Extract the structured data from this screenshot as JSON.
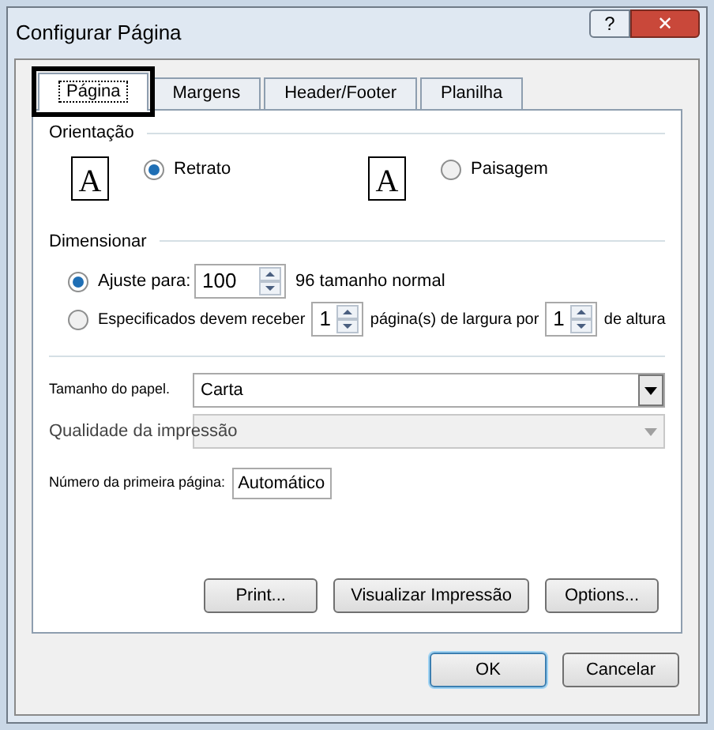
{
  "window": {
    "title": "Configurar Página",
    "help_glyph": "?",
    "close_glyph": "✕"
  },
  "tabs": [
    {
      "label": "Página",
      "selected": true,
      "highlighted": true
    },
    {
      "label": "Margens",
      "selected": false,
      "highlighted": false
    },
    {
      "label": "Header/Footer",
      "selected": false,
      "highlighted": false
    },
    {
      "label": "Planilha",
      "selected": false,
      "highlighted": false
    }
  ],
  "orientation": {
    "title": "Orientação",
    "options": [
      {
        "label": "Retrato",
        "selected": true,
        "icon_letter": "A"
      },
      {
        "label": "Paisagem",
        "selected": false,
        "icon_letter": "A"
      }
    ]
  },
  "scaling": {
    "title": "Dimensionar",
    "adjust": {
      "label": "Ajuste para:",
      "selected": true,
      "value": "100",
      "suffix": "96 tamanho normal"
    },
    "fit": {
      "label": "Especificados devem receber",
      "selected": false,
      "width_value": "1",
      "middle": "página(s) de largura por",
      "height_value": "1",
      "suffix": "de altura"
    }
  },
  "paper_size": {
    "label": "Tamanho do papel.",
    "value": "Carta",
    "disabled": false
  },
  "print_quality": {
    "label": "Qualidade da impressão",
    "disabled": true
  },
  "first_page": {
    "label": "Número da primeira página:",
    "value": "Automático"
  },
  "panel_buttons": [
    "Print...",
    "Visualizar Impressão",
    "Options..."
  ],
  "dialog_buttons": [
    {
      "label": "OK",
      "default": true
    },
    {
      "label": "Cancelar",
      "default": false
    }
  ]
}
